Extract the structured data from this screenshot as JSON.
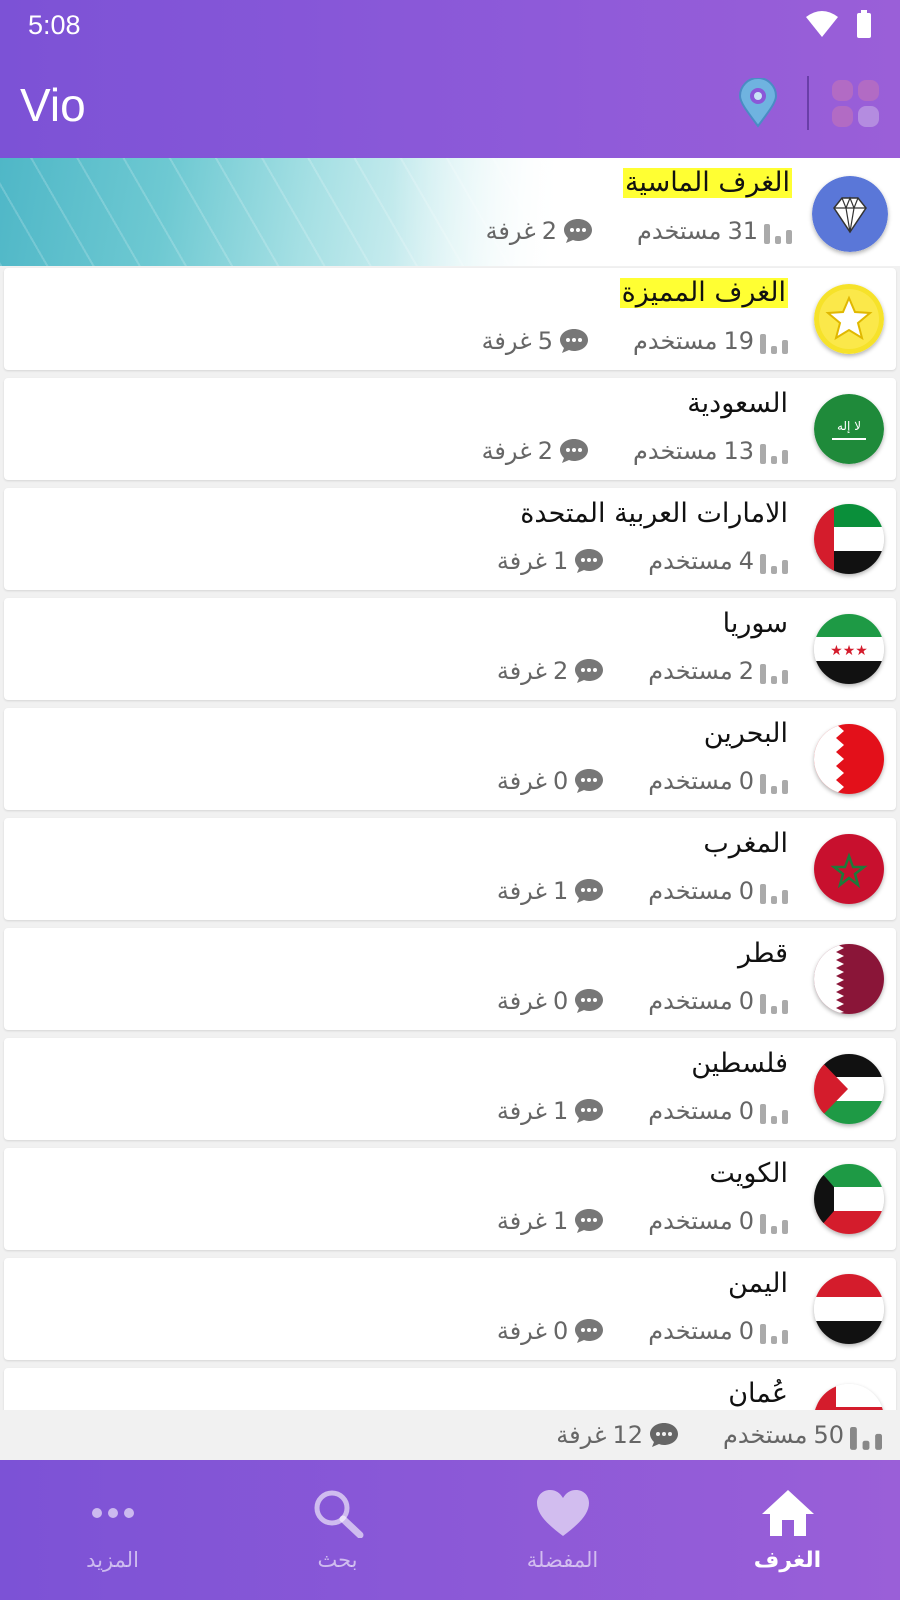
{
  "status_bar": {
    "time": "5:08"
  },
  "app": {
    "title": "Vio"
  },
  "rooms": [
    {
      "name": "الغرف الماسية",
      "users": "31",
      "rooms": "2",
      "highlight": true,
      "icon": "diamond-icon"
    },
    {
      "name": "الغرف المميزة",
      "users": "19",
      "rooms": "5",
      "highlight": true,
      "icon": "star-icon"
    },
    {
      "name": "السعودية",
      "users": "13",
      "rooms": "2",
      "icon": "flag-saudi-icon"
    },
    {
      "name": "الامارات العربية المتحدة",
      "users": "4",
      "rooms": "1",
      "icon": "flag-uae-icon"
    },
    {
      "name": "سوريا",
      "users": "2",
      "rooms": "2",
      "icon": "flag-syria-icon"
    },
    {
      "name": "البحرين",
      "users": "0",
      "rooms": "0",
      "icon": "flag-bahrain-icon"
    },
    {
      "name": "المغرب",
      "users": "0",
      "rooms": "1",
      "icon": "flag-morocco-icon"
    },
    {
      "name": "قطر",
      "users": "0",
      "rooms": "0",
      "icon": "flag-qatar-icon"
    },
    {
      "name": "فلسطين",
      "users": "0",
      "rooms": "1",
      "icon": "flag-palestine-icon"
    },
    {
      "name": "الكويت",
      "users": "0",
      "rooms": "1",
      "icon": "flag-kuwait-icon"
    },
    {
      "name": "اليمن",
      "users": "0",
      "rooms": "0",
      "icon": "flag-yemen-icon"
    },
    {
      "name": "عُمان",
      "icon": "flag-oman-icon"
    }
  ],
  "labels": {
    "users": "مستخدم",
    "rooms": "غرفة"
  },
  "totals": {
    "users": "50",
    "rooms": "12"
  },
  "nav": [
    {
      "label": "الغرف",
      "icon": "home-icon",
      "active": true
    },
    {
      "label": "المفضلة",
      "icon": "heart-icon"
    },
    {
      "label": "بحث",
      "icon": "search-icon"
    },
    {
      "label": "المزيد",
      "icon": "more-icon"
    }
  ],
  "colors": {
    "primary": "#8a58d8",
    "highlight": "#ffff33",
    "text_secondary": "#666666"
  }
}
